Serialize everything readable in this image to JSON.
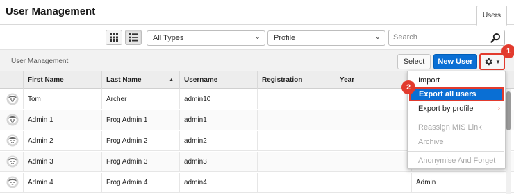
{
  "header": {
    "title": "User Management",
    "tab_users": "Users"
  },
  "toolbar": {
    "type_select": "All Types",
    "profile_select": "Profile",
    "search_placeholder": "Search"
  },
  "subbar": {
    "label": "User Management",
    "select_label": "Select",
    "new_user_label": "New User"
  },
  "table": {
    "columns": [
      "First Name",
      "Last Name",
      "Username",
      "Registration",
      "Year"
    ],
    "rows": [
      {
        "first": "Tom",
        "last": "Archer",
        "username": "admin10",
        "extra": ""
      },
      {
        "first": "Admin 1",
        "last": "Frog Admin 1",
        "username": "admin1",
        "extra": ""
      },
      {
        "first": "Admin 2",
        "last": "Frog Admin 2",
        "username": "admin2",
        "extra": ""
      },
      {
        "first": "Admin 3",
        "last": "Frog Admin 3",
        "username": "admin3",
        "extra": ""
      },
      {
        "first": "Admin 4",
        "last": "Frog Admin 4",
        "username": "admin4",
        "extra": "Admin"
      }
    ]
  },
  "menu": {
    "items": [
      {
        "label": "Import",
        "state": "enabled"
      },
      {
        "label": "Export all users",
        "state": "highlighted"
      },
      {
        "label": "Export by profile",
        "state": "enabled"
      },
      {
        "label": "Reassign MIS Link",
        "state": "disabled"
      },
      {
        "label": "Archive",
        "state": "disabled"
      },
      {
        "label": "Anonymise And Forget",
        "state": "disabled"
      }
    ]
  },
  "callouts": [
    "1",
    "2"
  ],
  "colors": {
    "accent": "#0a6fd4",
    "callout": "#e23b2e"
  }
}
